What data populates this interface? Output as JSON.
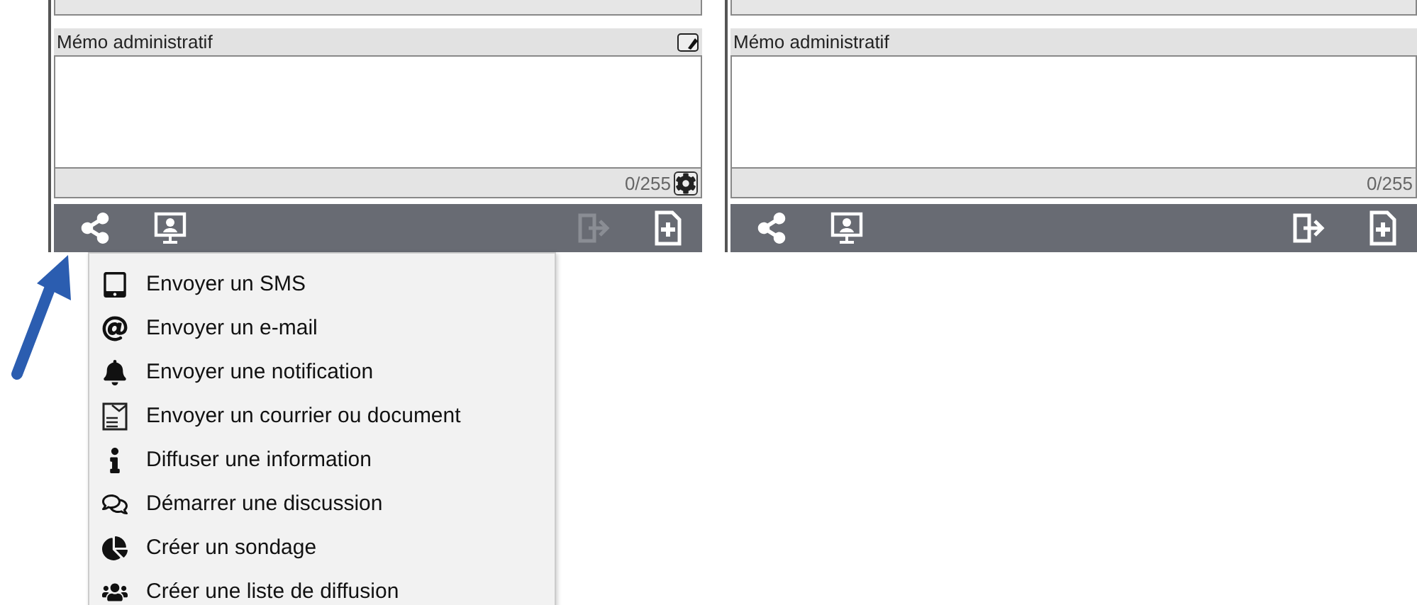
{
  "panels": [
    {
      "memo_label": "Mémo administratif",
      "counter": "0/255",
      "export_disabled": true
    },
    {
      "memo_label": "Mémo administratif",
      "counter": "0/255",
      "export_disabled": false
    }
  ],
  "share_menu": {
    "items": [
      {
        "label": "Envoyer un SMS"
      },
      {
        "label": "Envoyer un e-mail"
      },
      {
        "label": "Envoyer une notification"
      },
      {
        "label": "Envoyer un courrier ou document"
      },
      {
        "label": "Diffuser une information"
      },
      {
        "label": "Démarrer une discussion"
      },
      {
        "label": "Créer un sondage"
      },
      {
        "label": "Créer une liste de diffusion"
      }
    ]
  }
}
